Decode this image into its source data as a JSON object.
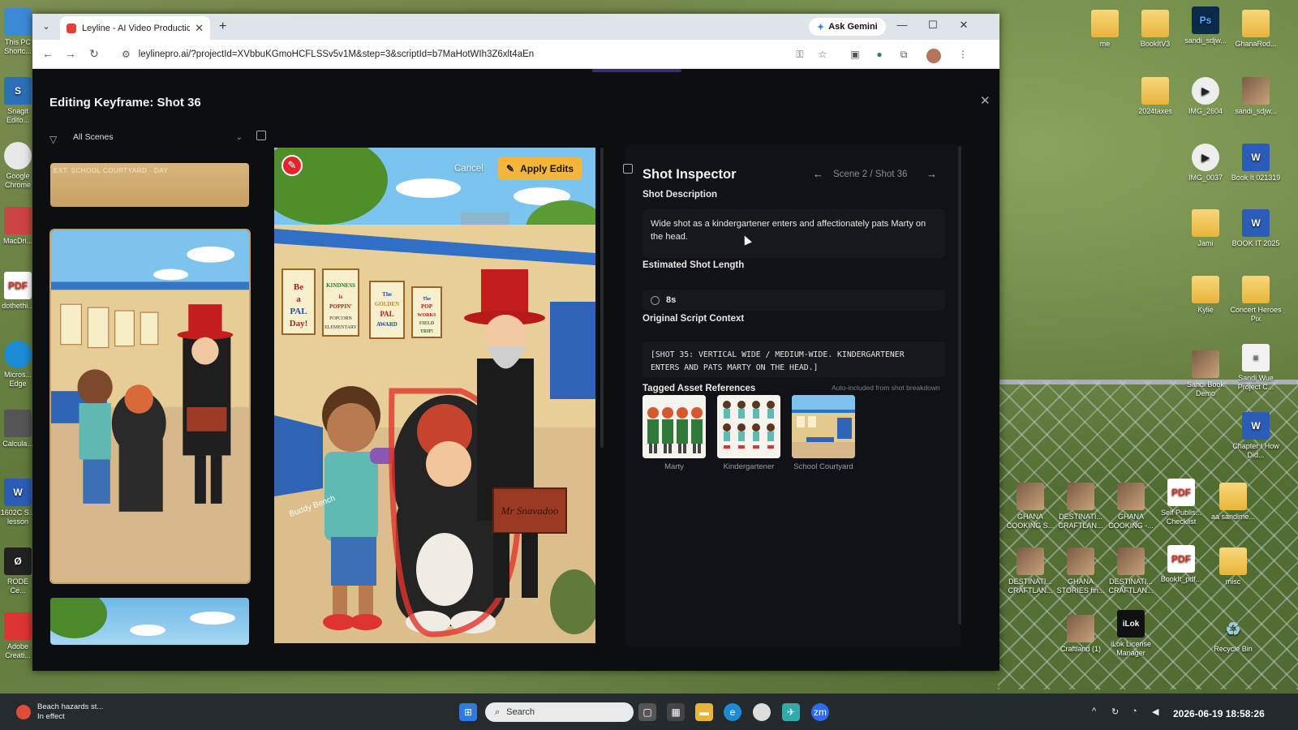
{
  "browser": {
    "tab_title": "Leyline - AI Video Production P",
    "url": "leylinepro.ai/?projectId=XVbbuKGmoHCFLSSv5v1M&step=3&scriptId=b7MaHotWIh3Z6xlt4aEn",
    "ask_gemini": "Ask Gemini"
  },
  "editor": {
    "title": "Editing Keyframe: Shot 36",
    "scene_filter": "All Scenes",
    "scene_strip_label": "EXT. SCHOOL COURTYARD - DAY",
    "cancel_label": "Cancel",
    "apply_label": "Apply Edits",
    "image_signs": [
      "Be a PAL Day!",
      "Kindness is Poppin' at Popcorn Elementary",
      "The Golden PAL Award",
      "The Pop Works Field Trip!"
    ],
    "box_label": "Mr Snavadoo",
    "bench_label": "Buddy Bench"
  },
  "inspector": {
    "title": "Shot Inspector",
    "scene_shot": "Scene 2 / Shot 36",
    "description_label": "Shot Description",
    "description": "Wide shot as a kindergartener enters and affectionately pats Marty on the head.",
    "length_label": "Estimated Shot Length",
    "length": "8s",
    "script_label": "Original Script Context",
    "script_context": "[SHOT 35: VERTICAL WIDE / MEDIUM-WIDE. KINDERGARTENER ENTERS AND PATS MARTY ON THE HEAD.]",
    "assets_label": "Tagged Asset References",
    "assets_note": "Auto-included from shot breakdown",
    "assets": [
      {
        "name": "Marty"
      },
      {
        "name": "Kindergartener"
      },
      {
        "name": "School Courtyard"
      }
    ]
  },
  "desktop_icons": [
    {
      "label": "me",
      "type": "folder"
    },
    {
      "label": "BookItV3",
      "type": "folder"
    },
    {
      "label": "sandi_sdjw...",
      "type": "ps"
    },
    {
      "label": "GhanaRod...",
      "type": "folder"
    },
    {
      "label": "2024taxes",
      "type": "folder"
    },
    {
      "label": "IMG_2604",
      "type": "media"
    },
    {
      "label": "sandi_sdjw...",
      "type": "thumb"
    },
    {
      "label": "IMG_0037",
      "type": "media"
    },
    {
      "label": "Book It 021319",
      "type": "word"
    },
    {
      "label": "Jami",
      "type": "folder"
    },
    {
      "label": "BOOK IT 2025",
      "type": "word"
    },
    {
      "label": "Kylie",
      "type": "folder"
    },
    {
      "label": "Concert Heroes Pix",
      "type": "folder"
    },
    {
      "label": "Sandi Book Demo",
      "type": "thumb"
    },
    {
      "label": "Sandi Wue Project C...",
      "type": "doc"
    },
    {
      "label": "Chapter I How Did...",
      "type": "word"
    },
    {
      "label": "GHANA COOKING S...",
      "type": "thumb"
    },
    {
      "label": "DESTINATI... CRAFTLAN...",
      "type": "thumb"
    },
    {
      "label": "GHANA COOKING -...",
      "type": "thumb"
    },
    {
      "label": "Self Publis... Checklist",
      "type": "pdf"
    },
    {
      "label": "aa sandime...",
      "type": "folder"
    },
    {
      "label": "DESTINATI... CRAFTLAN...",
      "type": "thumb"
    },
    {
      "label": "GHANA STORIES fin...",
      "type": "thumb"
    },
    {
      "label": "DESTINATI... CRAFTLAN...",
      "type": "thumb"
    },
    {
      "label": "BookIt_pdf...",
      "type": "pdf"
    },
    {
      "label": "misc",
      "type": "folder"
    },
    {
      "label": "Craftland (1)",
      "type": "thumb"
    },
    {
      "label": "iLok License Manager",
      "type": "ilok"
    },
    {
      "label": "Recycle Bin",
      "type": "bin"
    }
  ],
  "left_icons": [
    "This PC Shortc...",
    "Snagit Edito...",
    "Google Chrome",
    "MacDri...",
    "dothethi...",
    "Micros... Edge",
    "Calcula...",
    "1602C S... lesson",
    "RODE Ce...",
    "Adobe Creati..."
  ],
  "taskbar": {
    "weather_line1": "Beach hazards st...",
    "weather_line2": "In effect",
    "search_placeholder": "Search",
    "datetime": "2026-06-19 18:58:26"
  }
}
